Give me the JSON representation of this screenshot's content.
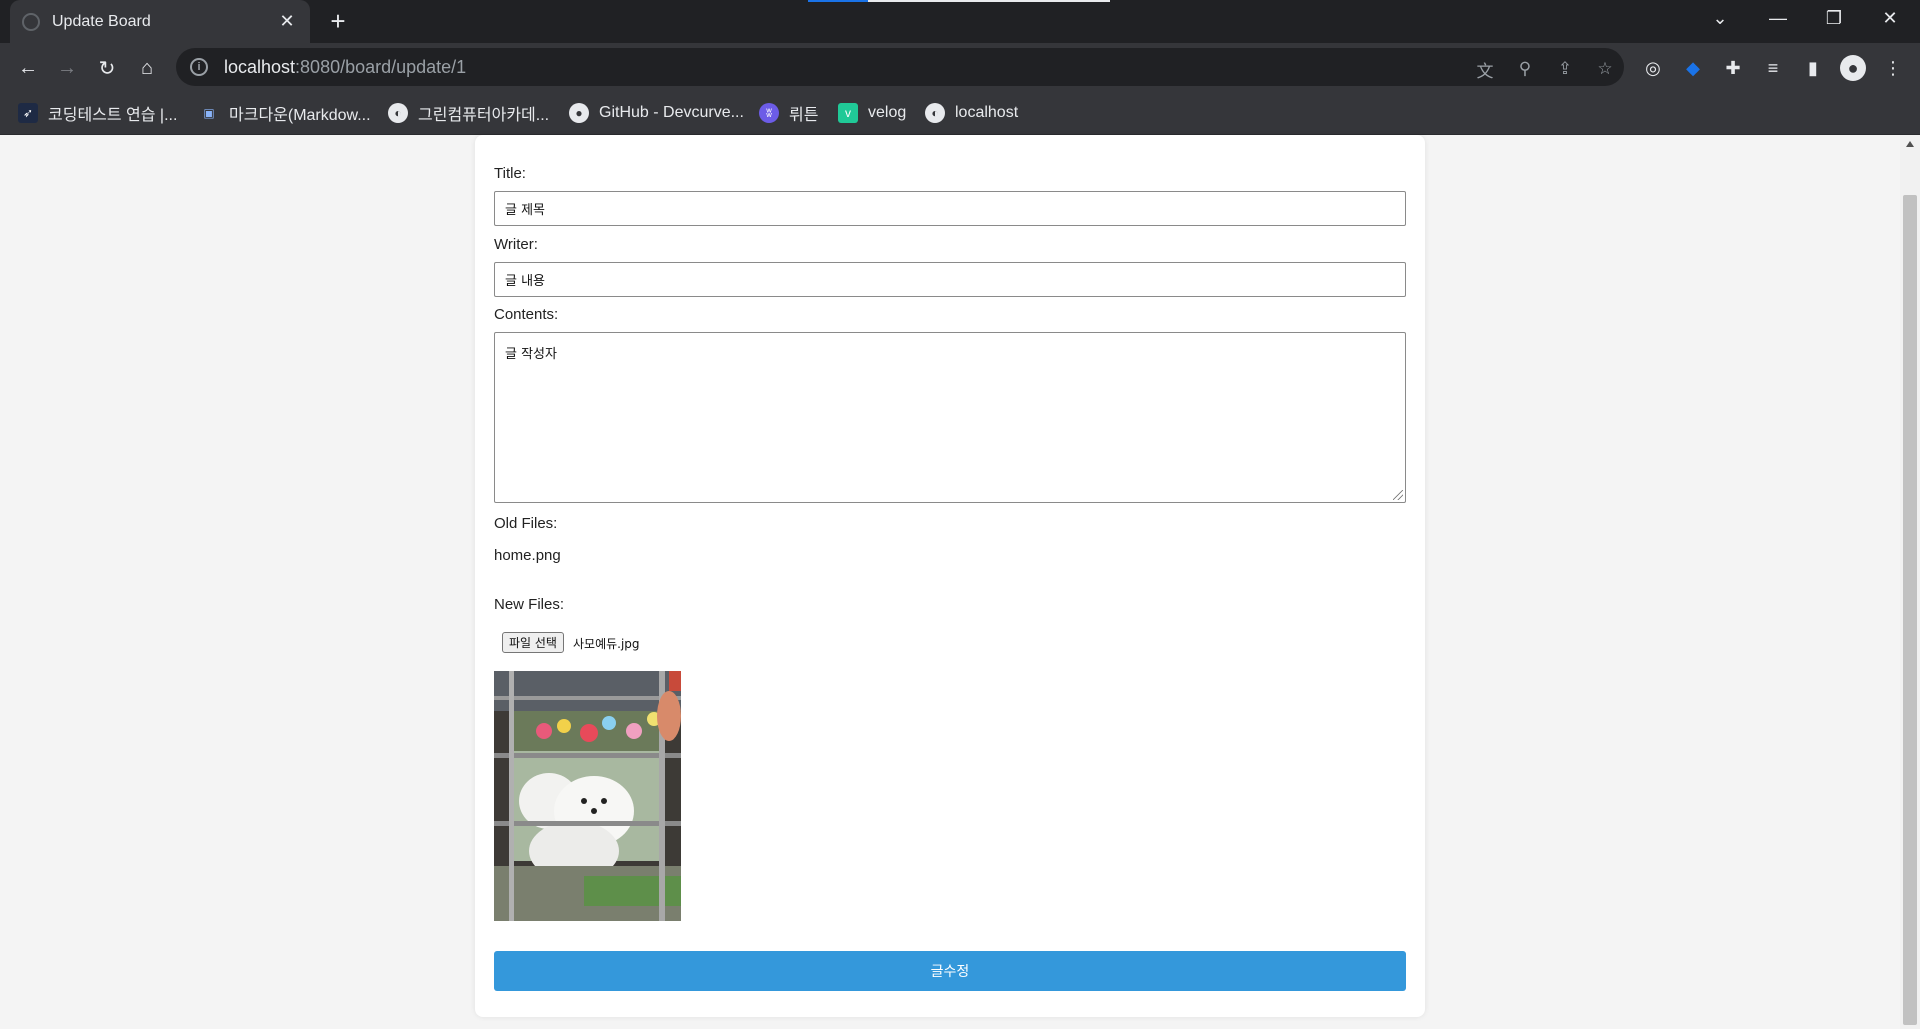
{
  "browser": {
    "tab_title": "Update Board",
    "new_tab": "+",
    "url_host": "localhost",
    "url_path": ":8080/board/update/1",
    "bookmarks": [
      {
        "label": "코딩테스트 연습 |...",
        "icon": "bird-icon"
      },
      {
        "label": "마크다운(Markdow...",
        "icon": "window-icon"
      },
      {
        "label": "그린컴퓨터아카데...",
        "icon": "globe-icon"
      },
      {
        "label": "GitHub - Devcurve...",
        "icon": "github-icon"
      },
      {
        "label": "뤼튼",
        "icon": "wrtn-icon"
      },
      {
        "label": "velog",
        "icon": "velog-icon"
      },
      {
        "label": "localhost",
        "icon": "globe-icon"
      }
    ]
  },
  "form": {
    "title_label": "Title:",
    "title_value": "글 제목",
    "writer_label": "Writer:",
    "writer_value": "글 내용",
    "contents_label": "Contents:",
    "contents_value": "글 작성자",
    "old_files_label": "Old Files:",
    "old_file_name": "home.png",
    "new_files_label": "New Files:",
    "file_button": "파일 선택",
    "selected_file": "사모예듀.jpg",
    "submit_label": "글수정"
  },
  "colors": {
    "submit": "#3498db",
    "chrome_dark": "#202124",
    "chrome_toolbar": "#35363a"
  }
}
